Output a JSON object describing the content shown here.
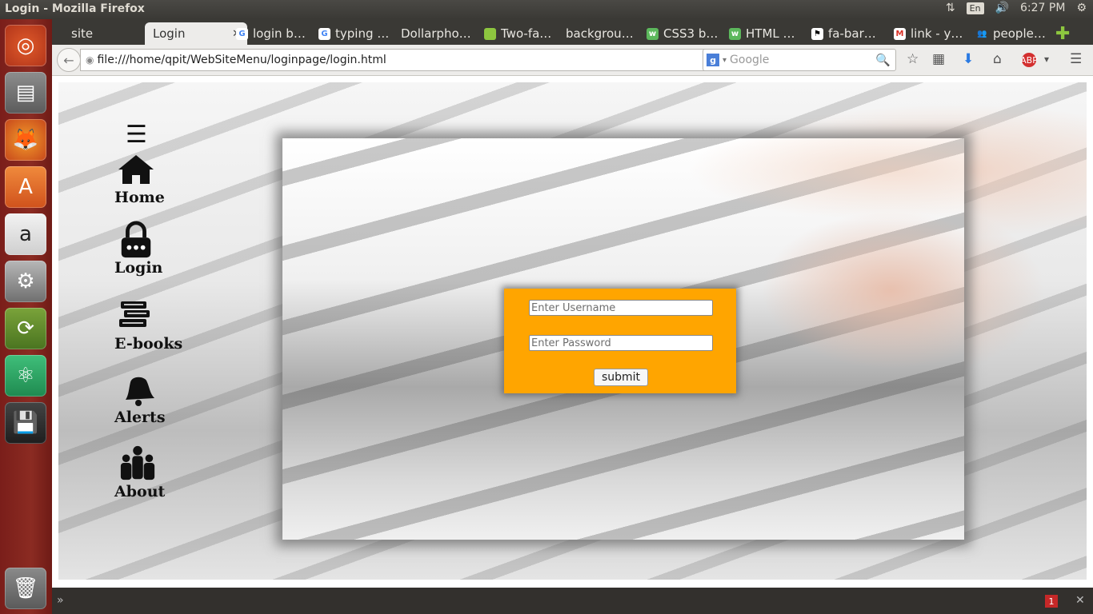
{
  "window": {
    "title": "Login - Mozilla Firefox"
  },
  "tray": {
    "keyboard": "En",
    "time": "6:27 PM"
  },
  "tabs": [
    {
      "label": "site"
    },
    {
      "label": "Login"
    },
    {
      "label": "login b…"
    },
    {
      "label": "typing …"
    },
    {
      "label": "Dollarpho…"
    },
    {
      "label": "Two-fa…"
    },
    {
      "label": "backgrou…"
    },
    {
      "label": "CSS3 b…"
    },
    {
      "label": "HTML …"
    },
    {
      "label": "fa-bar…"
    },
    {
      "label": "link - y…"
    },
    {
      "label": "people…"
    }
  ],
  "navbar": {
    "url": "file:///home/qpit/WebSiteMenu/loginpage/login.html",
    "search_engine": "Google",
    "search_placeholder": "Google"
  },
  "menu": {
    "items": [
      {
        "label": "Home",
        "icon": "home-icon"
      },
      {
        "label": "Login",
        "icon": "lock-icon"
      },
      {
        "label": "E-books",
        "icon": "books-icon"
      },
      {
        "label": "Alerts",
        "icon": "bell-icon"
      },
      {
        "label": "About",
        "icon": "people-icon"
      }
    ]
  },
  "login": {
    "username_placeholder": "Enter Username",
    "password_placeholder": "Enter Password",
    "submit_label": "submit"
  },
  "statusbar": {
    "badge": "1"
  },
  "colors": {
    "login_box": "#ffa500",
    "launcher": "#8b2b22"
  }
}
